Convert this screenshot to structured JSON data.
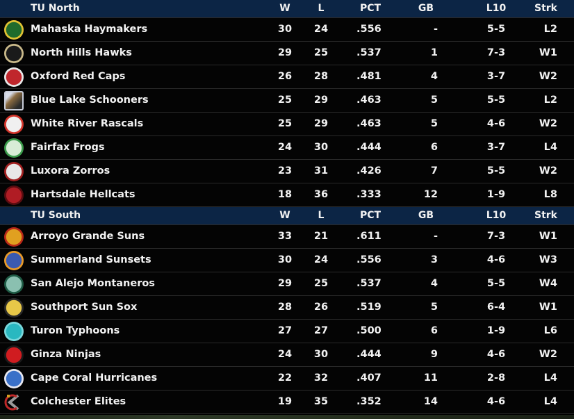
{
  "columns": {
    "w": "W",
    "l": "L",
    "pct": "PCT",
    "gb": "GB",
    "l10": "L10",
    "strk": "Strk"
  },
  "divisions": [
    {
      "name": "TU North",
      "teams": [
        {
          "name": "Mahaska Haymakers",
          "w": "30",
          "l": "24",
          "pct": ".556",
          "gb": "-",
          "l10": "5-5",
          "strk": "L2",
          "logo": "haymakers-logo",
          "logo_bg": "#1f6b2c",
          "logo_ring": "#e0c233",
          "logo_shape": "circle"
        },
        {
          "name": "North Hills Hawks",
          "w": "29",
          "l": "25",
          "pct": ".537",
          "gb": "1",
          "l10": "7-3",
          "strk": "W1",
          "logo": "hawks-logo",
          "logo_bg": "#1a1a1a",
          "logo_ring": "#c9b98a",
          "logo_shape": "circle"
        },
        {
          "name": "Oxford Red Caps",
          "w": "26",
          "l": "28",
          "pct": ".481",
          "gb": "4",
          "l10": "3-7",
          "strk": "W2",
          "logo": "red-caps-logo",
          "logo_bg": "#c0262c",
          "logo_ring": "#e8e8e8",
          "logo_shape": "circle"
        },
        {
          "name": "Blue Lake Schooners",
          "w": "25",
          "l": "29",
          "pct": ".463",
          "gb": "5",
          "l10": "5-5",
          "strk": "L2",
          "logo": "schooners-logo",
          "logo_bg": "#8a6a40",
          "logo_ring": "#c8ccd8",
          "logo_shape": "square"
        },
        {
          "name": "White River Rascals",
          "w": "25",
          "l": "29",
          "pct": ".463",
          "gb": "5",
          "l10": "4-6",
          "strk": "W2",
          "logo": "rascals-logo",
          "logo_bg": "#f0f0f0",
          "logo_ring": "#d2342a",
          "logo_shape": "circle"
        },
        {
          "name": "Fairfax Frogs",
          "w": "24",
          "l": "30",
          "pct": ".444",
          "gb": "6",
          "l10": "3-7",
          "strk": "L4",
          "logo": "frogs-logo",
          "logo_bg": "#d8ecd6",
          "logo_ring": "#3a9a4a",
          "logo_shape": "circle"
        },
        {
          "name": "Luxora Zorros",
          "w": "23",
          "l": "31",
          "pct": ".426",
          "gb": "7",
          "l10": "5-5",
          "strk": "W2",
          "logo": "zorros-logo",
          "logo_bg": "#e8e8e8",
          "logo_ring": "#a02020",
          "logo_shape": "circle"
        },
        {
          "name": "Hartsdale Hellcats",
          "w": "18",
          "l": "36",
          "pct": ".333",
          "gb": "12",
          "l10": "1-9",
          "strk": "L8",
          "logo": "hellcats-logo",
          "logo_bg": "#b01c24",
          "logo_ring": "#5a0c10",
          "logo_shape": "circle"
        }
      ]
    },
    {
      "name": "TU South",
      "teams": [
        {
          "name": "Arroyo Grande Suns",
          "w": "33",
          "l": "21",
          "pct": ".611",
          "gb": "-",
          "l10": "7-3",
          "strk": "W1",
          "logo": "suns-logo",
          "logo_bg": "#e0a020",
          "logo_ring": "#b82818",
          "logo_shape": "circle"
        },
        {
          "name": "Summerland Sunsets",
          "w": "30",
          "l": "24",
          "pct": ".556",
          "gb": "3",
          "l10": "4-6",
          "strk": "W3",
          "logo": "sunsets-logo",
          "logo_bg": "#3a5ab0",
          "logo_ring": "#e89a28",
          "logo_shape": "circle"
        },
        {
          "name": "San Alejo Montaneros",
          "w": "29",
          "l": "25",
          "pct": ".537",
          "gb": "4",
          "l10": "5-5",
          "strk": "W4",
          "logo": "montaneros-logo",
          "logo_bg": "#8ac0b0",
          "logo_ring": "#1e5a44",
          "logo_shape": "circle"
        },
        {
          "name": "Southport Sun Sox",
          "w": "28",
          "l": "26",
          "pct": ".519",
          "gb": "5",
          "l10": "6-4",
          "strk": "W1",
          "logo": "sun-sox-logo",
          "logo_bg": "#e8c848",
          "logo_ring": "#2a2a2a",
          "logo_shape": "circle"
        },
        {
          "name": "Turon Typhoons",
          "w": "27",
          "l": "27",
          "pct": ".500",
          "gb": "6",
          "l10": "1-9",
          "strk": "L6",
          "logo": "typhoons-logo",
          "logo_bg": "#2ab8c0",
          "logo_ring": "#7ad8dc",
          "logo_shape": "circle"
        },
        {
          "name": "Ginza Ninjas",
          "w": "24",
          "l": "30",
          "pct": ".444",
          "gb": "9",
          "l10": "4-6",
          "strk": "W2",
          "logo": "ninjas-logo",
          "logo_bg": "#d01c20",
          "logo_ring": "#1a1a1a",
          "logo_shape": "circle"
        },
        {
          "name": "Cape Coral Hurricanes",
          "w": "22",
          "l": "32",
          "pct": ".407",
          "gb": "11",
          "l10": "2-8",
          "strk": "L4",
          "logo": "hurricanes-logo",
          "logo_bg": "#3a70c8",
          "logo_ring": "#e8e8f0",
          "logo_shape": "circle"
        },
        {
          "name": "Colchester Elites",
          "w": "19",
          "l": "35",
          "pct": ".352",
          "gb": "14",
          "l10": "4-6",
          "strk": "L4",
          "logo": "elites-logo",
          "logo_bg": "#c02828",
          "logo_ring": "#9a9a9a",
          "logo_shape": "emblem"
        }
      ]
    }
  ]
}
